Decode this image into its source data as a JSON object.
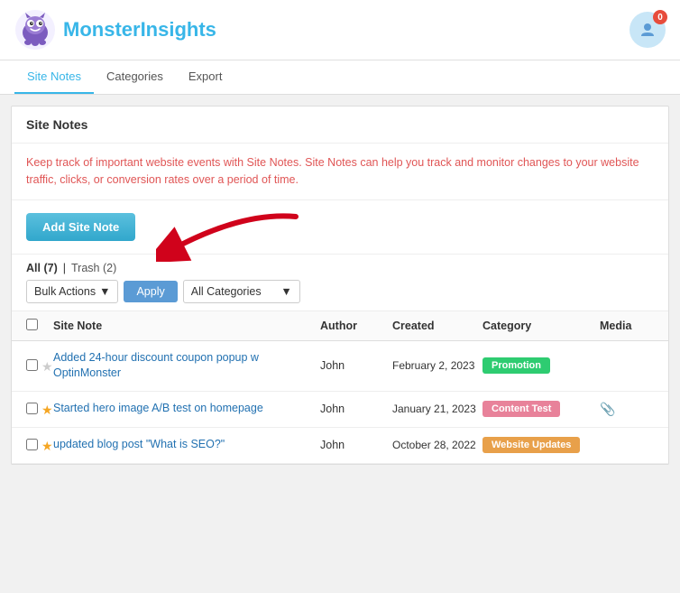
{
  "header": {
    "logo_text_plain": "Monster",
    "logo_text_accent": "Insights",
    "notification_count": "0"
  },
  "tabs": [
    {
      "id": "site-notes",
      "label": "Site Notes",
      "active": true
    },
    {
      "id": "categories",
      "label": "Categories",
      "active": false
    },
    {
      "id": "export",
      "label": "Export",
      "active": false
    }
  ],
  "section": {
    "title": "Site Notes",
    "description": "Keep track of important website events with Site Notes. Site Notes can help you track and monitor changes to your website traffic, clicks, or conversion rates over a period of time.",
    "add_button_label": "Add Site Note"
  },
  "filters": {
    "all_label": "All",
    "all_count": "(7)",
    "trash_label": "Trash",
    "trash_count": "(2)",
    "bulk_actions_label": "Bulk Actions",
    "apply_label": "Apply",
    "all_categories_label": "All Categories"
  },
  "table": {
    "columns": [
      "",
      "Site Note",
      "Author",
      "Created",
      "Category",
      "Media"
    ],
    "rows": [
      {
        "id": 1,
        "starred": false,
        "note": "Added 24-hour discount coupon popup w OptinMonster",
        "author": "John",
        "created": "February 2, 2023",
        "category": "Promotion",
        "category_class": "badge-promotion",
        "media": ""
      },
      {
        "id": 2,
        "starred": true,
        "note": "Started hero image A/B test on homepage",
        "author": "John",
        "created": "January 21, 2023",
        "category": "Content Test",
        "category_class": "badge-content-test",
        "media": "paperclip"
      },
      {
        "id": 3,
        "starred": true,
        "note": "updated blog post \"What is SEO?\"",
        "author": "John",
        "created": "October 28, 2022",
        "category": "Website Updates",
        "category_class": "badge-website-updates",
        "media": ""
      }
    ]
  }
}
